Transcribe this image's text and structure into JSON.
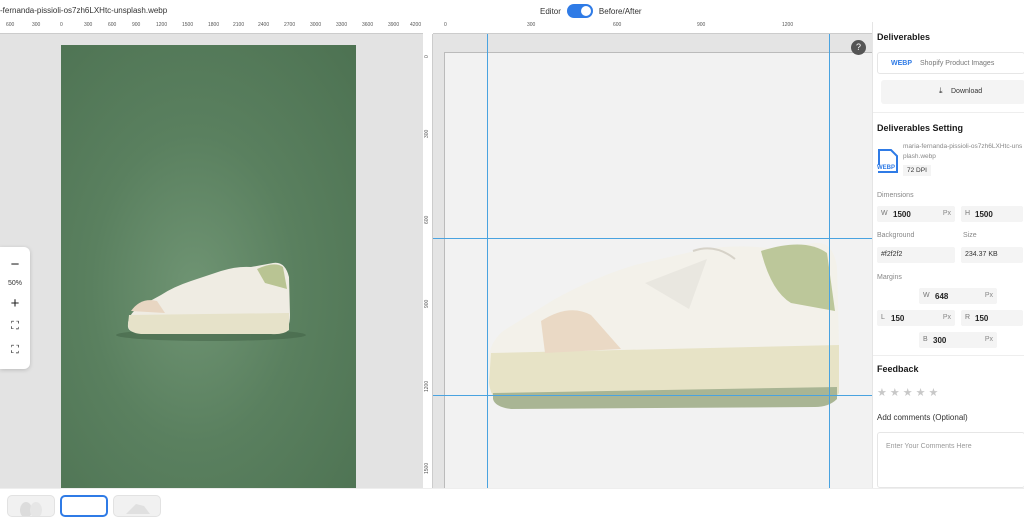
{
  "header": {
    "filename": "-fernanda-pissioli-os7zh6LXHtc-unsplash.webp",
    "editor_label": "Editor",
    "before_after_label": "Before/After"
  },
  "rulers": {
    "left_top": [
      "600",
      "300",
      "0",
      "300",
      "600",
      "900",
      "1200",
      "1500",
      "1800",
      "2100",
      "2400",
      "2700",
      "3000",
      "3300",
      "3600",
      "3900",
      "4200"
    ],
    "right_top": [
      "0",
      "300",
      "600",
      "900",
      "1200"
    ],
    "right_left": [
      "0",
      "300",
      "600",
      "900",
      "1200",
      "1500"
    ]
  },
  "zoom": {
    "minus_icon": "minus-icon",
    "level": "50%",
    "plus_icon": "plus-icon",
    "fit_icon": "fit-screen-icon",
    "expand_icon": "expand-icon"
  },
  "canvas": {
    "help_icon": "question-icon",
    "help_glyph": "?"
  },
  "sidebar": {
    "deliverables_title": "Deliverables",
    "deliverable_format": "WEBP",
    "deliverable_name": "Shopify Product Images",
    "download_label": "Download",
    "settings_title": "Deliverables Setting",
    "file_name": "maria-fernanda-pissioli-os7zh6LXHtc-unsplash.webp",
    "file_badge": "WEBP",
    "dpi": "72 DPI",
    "dimensions_label": "Dimensions",
    "width_prefix": "W",
    "width_value": "1500",
    "width_unit": "Px",
    "height_prefix": "H",
    "height_value": "1500",
    "background_label": "Background",
    "background_value": "#f2f2f2",
    "size_label": "Size",
    "size_value": "234.37 KB",
    "margins_label": "Margins",
    "margin_top_prefix": "W",
    "margin_top_value": "648",
    "margin_left_prefix": "L",
    "margin_left_value": "150",
    "margin_right_prefix": "R",
    "margin_right_value": "150",
    "margin_bottom_prefix": "B",
    "margin_bottom_value": "300",
    "margin_unit": "Px",
    "feedback_title": "Feedback",
    "stars": [
      "★",
      "★",
      "★",
      "★",
      "★"
    ],
    "comments_label": "Add comments (Optional)",
    "comments_placeholder": "Enter Your Comments Here"
  },
  "colors": {
    "accent": "#2f7be6",
    "guide": "#4aa3e0",
    "artboard_bg": "#f2f2f2",
    "photo_green": "#5a805f"
  }
}
